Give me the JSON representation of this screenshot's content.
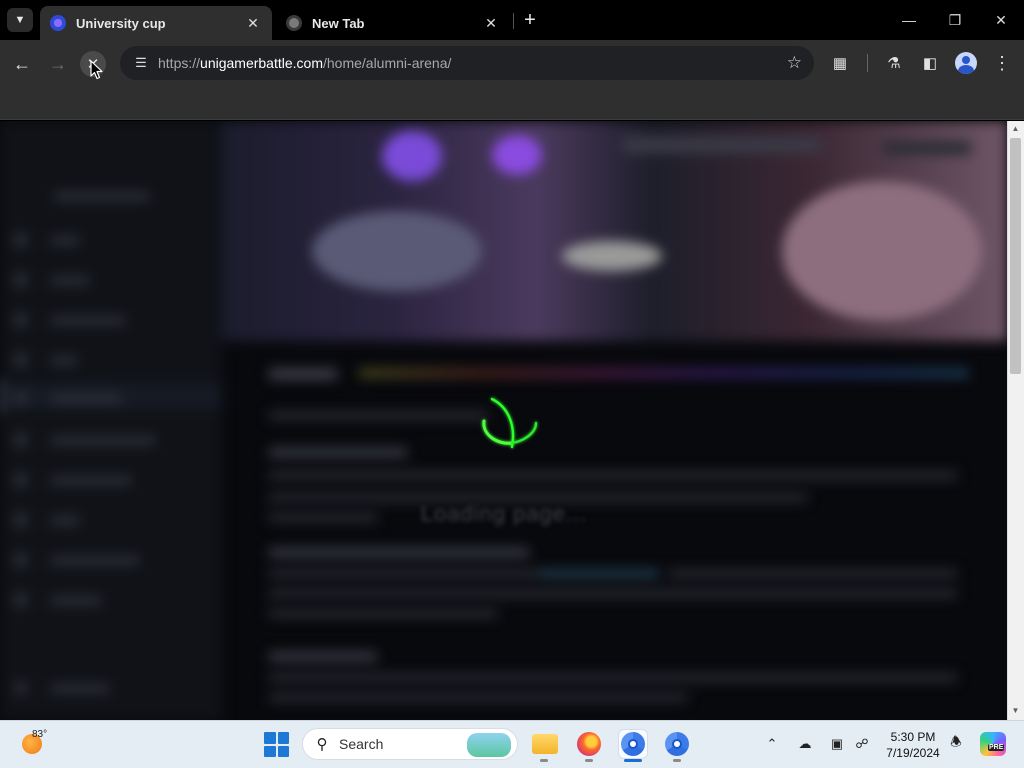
{
  "browser": {
    "tabs": [
      {
        "title": "University cup",
        "active": true
      },
      {
        "title": "New Tab",
        "active": false
      }
    ],
    "address_bar": {
      "scheme": "https://",
      "host": "unigamerbattle.com",
      "path": "/home/alumni-arena/"
    }
  },
  "page": {
    "loading_text": "Loading page...",
    "accent_color": "#39ff3a"
  },
  "taskbar": {
    "weather_temp": "83°",
    "search_placeholder": "Search",
    "time": "5:30 PM",
    "date": "7/19/2024",
    "copilot_badge": "PRE"
  },
  "icons": [
    "tab-search-icon",
    "new-tab-icon",
    "back-arrow-icon",
    "forward-arrow-icon",
    "stop-loading-icon",
    "site-info-icon",
    "bookmark-star-icon",
    "extensions-icon",
    "labs-flask-icon",
    "side-panel-icon",
    "profile-avatar-icon",
    "menu-kebab-icon",
    "windows-start-icon",
    "file-explorer-icon",
    "firefox-icon",
    "chrome-icon",
    "chevron-up-icon",
    "cloud-off-icon",
    "display-icon",
    "network-icon",
    "bell-icon",
    "copilot-icon"
  ]
}
